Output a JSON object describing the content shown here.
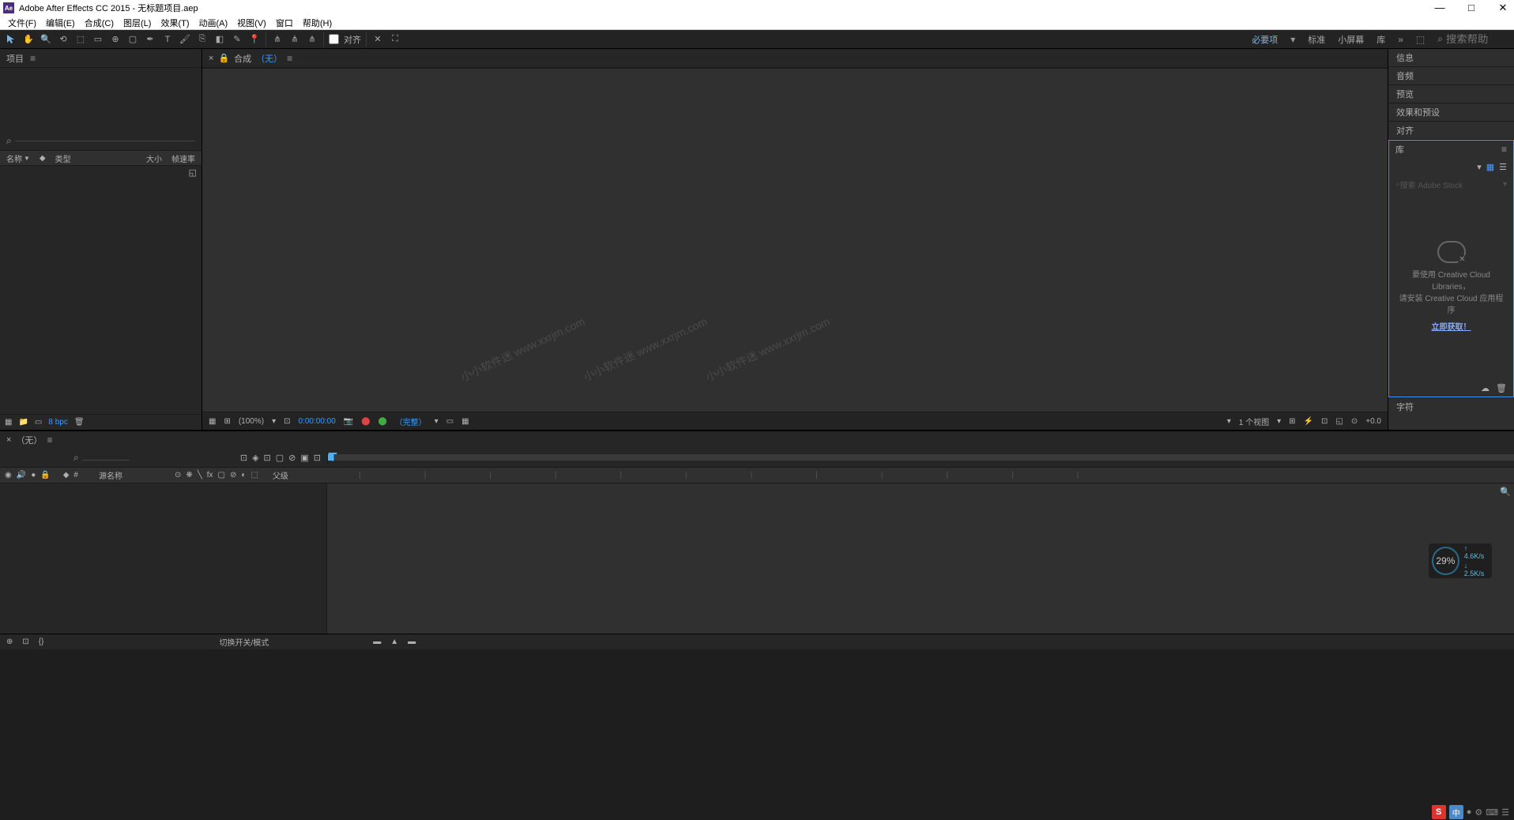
{
  "title": {
    "app": "Adobe After Effects CC 2015",
    "project": "无标题项目.aep"
  },
  "menu": [
    "文件(F)",
    "编辑(E)",
    "合成(C)",
    "图层(L)",
    "效果(T)",
    "动画(A)",
    "视图(V)",
    "窗口",
    "帮助(H)"
  ],
  "toolbar": {
    "snap_label": "对齐"
  },
  "workspace": {
    "active": "必要项",
    "items": [
      "标准",
      "小屏幕",
      "库"
    ],
    "search_placeholder": "搜索帮助"
  },
  "project_panel": {
    "title": "项目",
    "columns": {
      "name": "名称",
      "type": "类型",
      "size": "大小",
      "fps": "帧速率"
    },
    "bpc": "8 bpc"
  },
  "composition_panel": {
    "label": "合成",
    "none": "（无）",
    "footer": {
      "zoom": "(100%)",
      "timecode": "0:00:00:00",
      "full": "（完整）",
      "views": "1 个视图",
      "exposure": "+0.0"
    }
  },
  "right_panels": {
    "info": "信息",
    "audio": "音频",
    "preview": "预览",
    "effects": "效果和预设",
    "align": "对齐",
    "library": "库",
    "char": "字符",
    "lib_search": "搜索 Adobe Stock",
    "lib_msg1": "要使用 Creative Cloud Libraries，",
    "lib_msg2": "请安装 Creative Cloud 应用程序",
    "lib_link": "立即获取！"
  },
  "timeline": {
    "tab": "（无）",
    "source_name": "源名称",
    "parent": "父级",
    "toggle": "切换开关/模式"
  },
  "speed": {
    "percent": "29%",
    "up": "4.6K/s",
    "down": "2.5K/s"
  },
  "watermark": "小小软件迷 www.xxrjm.com"
}
